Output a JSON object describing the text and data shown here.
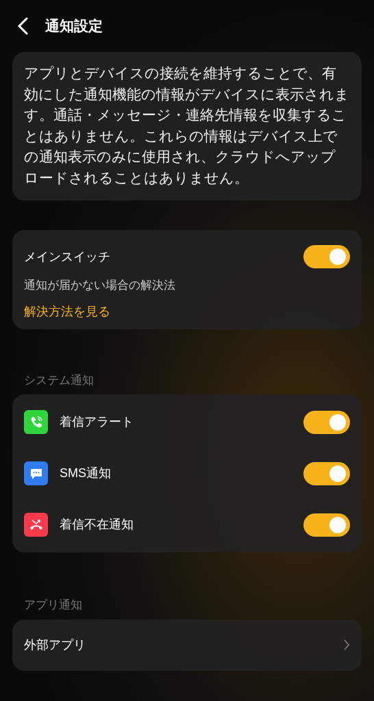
{
  "header": {
    "title": "通知設定"
  },
  "info": "アプリとデバイスの接続を維持することで、有効にした通知機能の情報がデバイスに表示されます。通話・メッセージ・連絡先情報を収集することはありません。これらの情報はデバイス上での通知表示のみに使用され、クラウドへアップロードされることはありません。",
  "main": {
    "label": "メインスイッチ",
    "on": true,
    "hint": "通知が届かない場合の解決法",
    "link": "解決方法を見る"
  },
  "system": {
    "heading": "システム通知",
    "items": [
      {
        "kind": "call",
        "label": "着信アラート",
        "on": true
      },
      {
        "kind": "sms",
        "label": "SMS通知",
        "on": true
      },
      {
        "kind": "missed",
        "label": "着信不在通知",
        "on": true
      }
    ]
  },
  "apps": {
    "heading": "アプリ通知",
    "items": [
      {
        "label": "外部アプリ"
      }
    ]
  }
}
